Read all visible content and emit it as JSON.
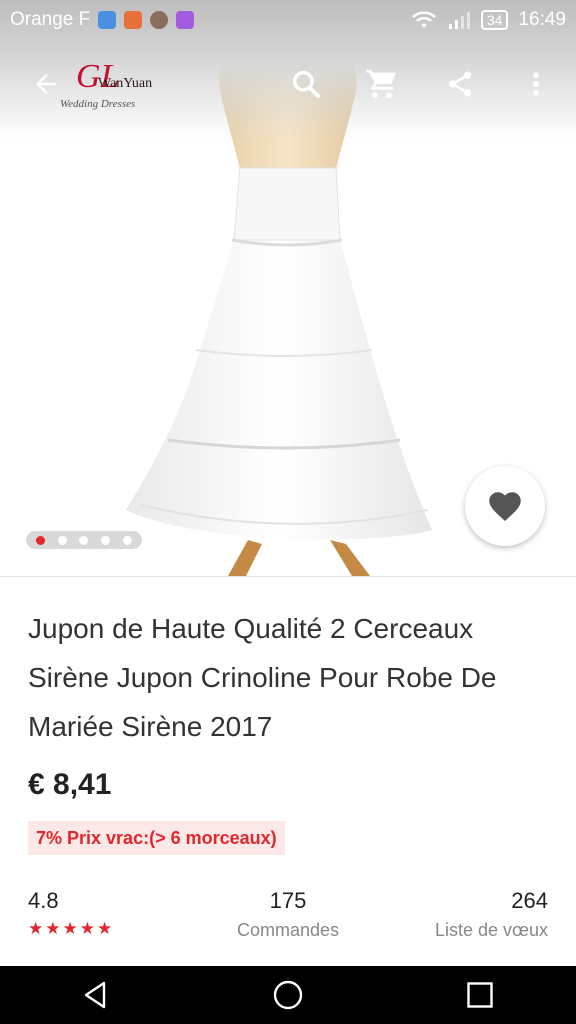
{
  "status_bar": {
    "carrier": "Orange F",
    "battery": "34",
    "time": "16:49"
  },
  "brand": {
    "letters": "GL",
    "name": "WanYuan",
    "tagline": "Wedding Dresses"
  },
  "toolbar": {
    "back_icon": "arrow-back-icon",
    "search_icon": "search-icon",
    "cart_icon": "cart-icon",
    "share_icon": "share-icon",
    "more_icon": "more-vert-icon"
  },
  "carousel": {
    "dot_count": 5,
    "active_index": 0
  },
  "wishlist_icon": "heart-icon",
  "product": {
    "title": "Jupon de Haute Qualité 2 Cerceaux Sirène Jupon Crinoline Pour Robe De Mariée Sirène 2017",
    "price": "€ 8,41",
    "bulk_discount": "7% Prix vrac:(> 6 morceaux)"
  },
  "stats": {
    "rating": "4.8",
    "stars": 5,
    "orders_value": "175",
    "orders_label": "Commandes",
    "wishlist_value": "264",
    "wishlist_label": "Liste de vœux"
  },
  "colors": {
    "accent": "#e0282c",
    "badge_bg": "#fde8e8"
  },
  "nav_bar": {
    "back_icon": "nav-back-icon",
    "home_icon": "nav-home-icon",
    "recents_icon": "nav-recents-icon"
  }
}
